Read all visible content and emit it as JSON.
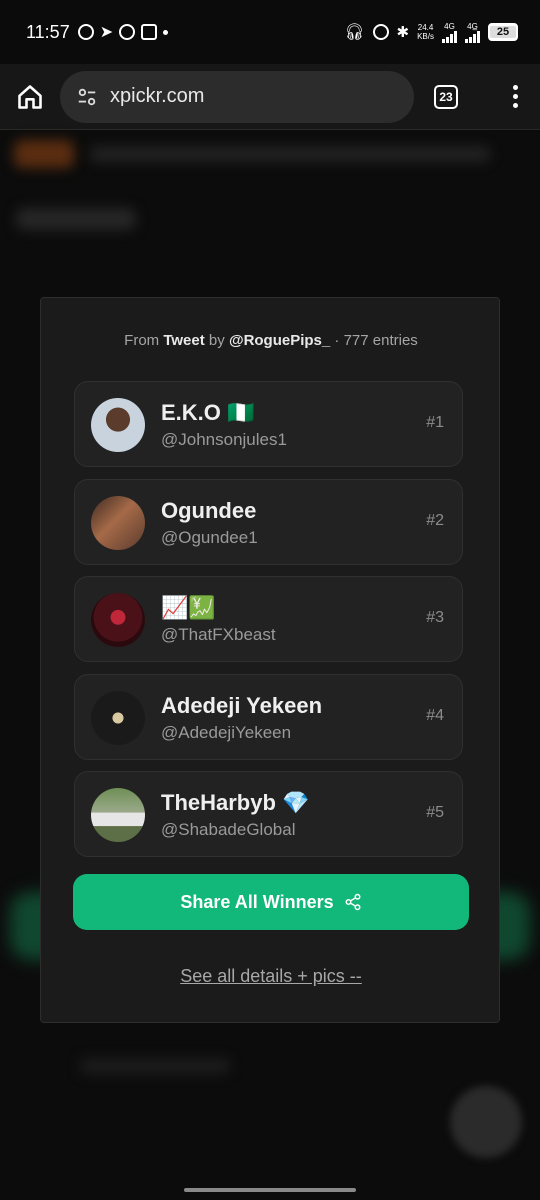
{
  "status": {
    "time": "11:57",
    "speed_top": "24.4",
    "speed_bottom": "KB/s",
    "network1": "4G",
    "network2": "4G̲",
    "battery": "25"
  },
  "browser": {
    "url": "xpickr.com",
    "tab_count": "23"
  },
  "modal": {
    "from_label": "From",
    "source": "Tweet",
    "by_label": "by",
    "author": "@RoguePips_",
    "entries": "· 777 entries",
    "winners": [
      {
        "name": "E.K.O 🇳🇬",
        "handle": "@Johnsonjules1",
        "rank": "#1",
        "avatar_color": "#8d9aa9"
      },
      {
        "name": "Ogundee",
        "handle": "@Ogundee1",
        "rank": "#2",
        "avatar_color": "#7a4a35"
      },
      {
        "name": "📈💹",
        "handle": "@ThatFXbeast",
        "rank": "#3",
        "avatar_color": "#3a0f14"
      },
      {
        "name": "Adedeji Yekeen",
        "handle": "@AdedejiYekeen",
        "rank": "#4",
        "avatar_color": "#151515"
      },
      {
        "name": "TheHarbyb 💎",
        "handle": "@ShabadeGlobal",
        "rank": "#5",
        "avatar_color": "#5b7a4a"
      }
    ],
    "share_label": "Share All Winners",
    "details_label": "See all details + pics --"
  }
}
